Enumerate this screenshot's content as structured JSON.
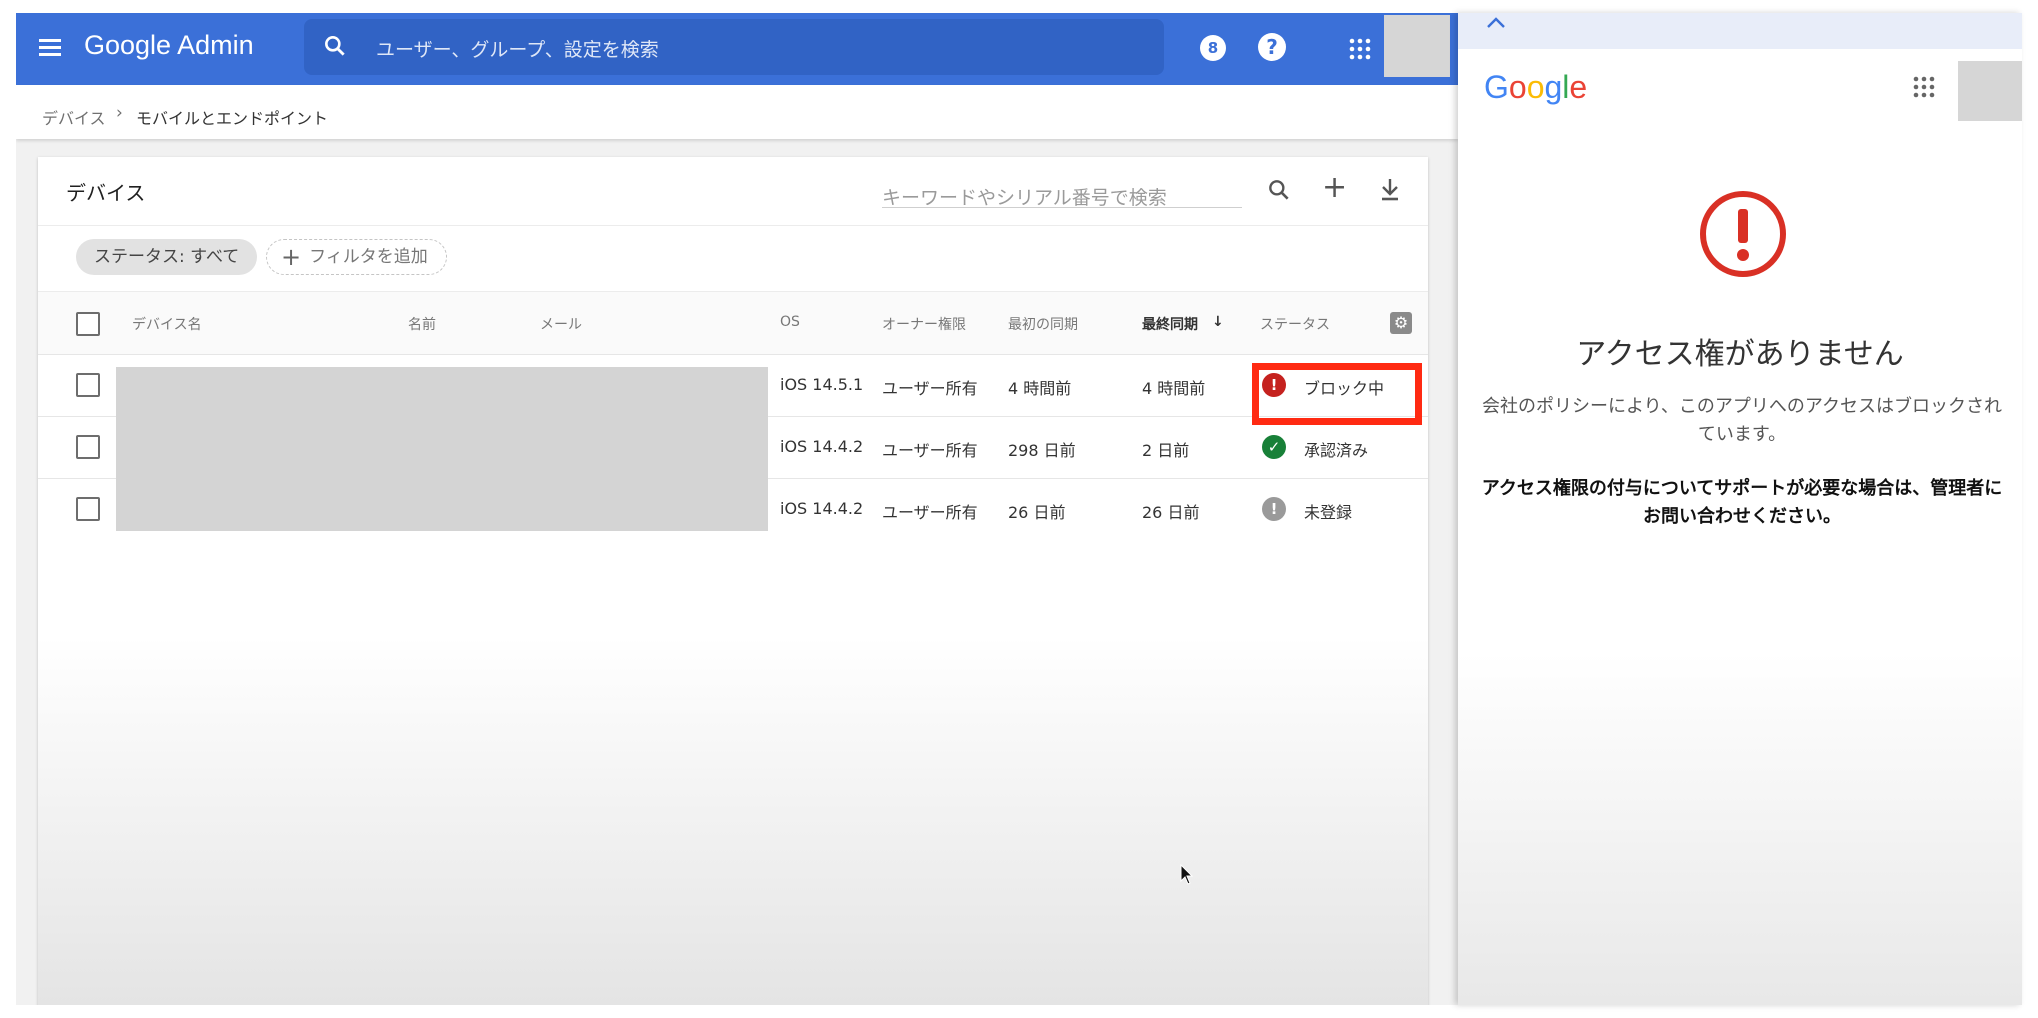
{
  "admin": {
    "brand": "Google Admin",
    "search_placeholder": "ユーザー、グループ、設定を検索",
    "notification_count": "8",
    "help_label": "?",
    "breadcrumb": {
      "parent": "デバイス",
      "separator": "›",
      "current": "モバイルとエンドポイント"
    },
    "card": {
      "title": "デバイス",
      "search_placeholder": "キーワードやシリアル番号で検索",
      "add_label": "+",
      "filters": {
        "status_chip": "ステータス: すべて",
        "add_filter_plus": "+",
        "add_filter": "フィルタを追加"
      },
      "columns": {
        "device_name": "デバイス名",
        "name": "名前",
        "email": "メール",
        "os": "OS",
        "ownership": "オーナー権限",
        "first_sync": "最初の同期",
        "last_sync": "最終同期",
        "sort_arrow": "↓",
        "status": "ステータス"
      },
      "rows": [
        {
          "os": "iOS 14.5.1",
          "ownership": "ユーザー所有",
          "first_sync": "4 時間前",
          "last_sync": "4 時間前",
          "status": "ブロック中",
          "status_glyph": "!",
          "status_color": "#c5221f"
        },
        {
          "os": "iOS 14.4.2",
          "ownership": "ユーザー所有",
          "first_sync": "298 日前",
          "last_sync": "2 日前",
          "status": "承認済み",
          "status_glyph": "✓",
          "status_color": "#188038"
        },
        {
          "os": "iOS 14.4.2",
          "ownership": "ユーザー所有",
          "first_sync": "26 日前",
          "last_sync": "26 日前",
          "status": "未登録",
          "status_glyph": "!",
          "status_color": "#9a9a9a"
        }
      ]
    },
    "colors": {
      "header": "#3b70d8",
      "highlight": "#ff2a12"
    }
  },
  "access_panel": {
    "logo": {
      "G": "G",
      "o1": "o",
      "o2": "o",
      "g": "g",
      "l": "l",
      "e": "e"
    },
    "title": "アクセス権がありません",
    "message": "会社のポリシーにより、このアプリへのアクセスはブロックされています。",
    "support": "アクセス権限の付与についてサポートが必要な場合は、管理者にお問い合わせください。",
    "alert_color": "#d93025"
  }
}
